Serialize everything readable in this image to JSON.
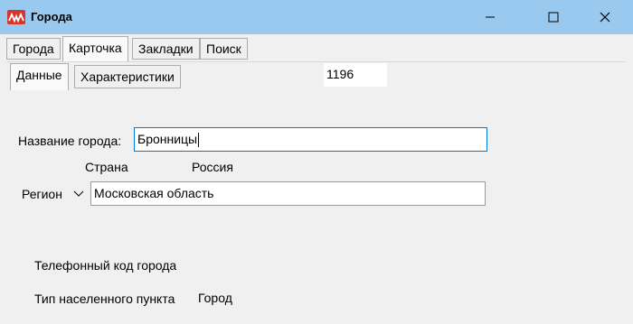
{
  "window": {
    "title": "Города"
  },
  "tabs": [
    "Города",
    "Карточка",
    "Закладки",
    "Поиск"
  ],
  "subtabs": [
    "Данные",
    "Характеристики"
  ],
  "record_id": "1196",
  "form": {
    "city_name_label": "Название города:",
    "city_name_value": "Бронницы",
    "country_label": "Страна",
    "country_value": "Россия",
    "region_label": "Регион",
    "region_value": "Московская область",
    "phone_code_label": "Телефонный код города",
    "settlement_type_label": "Тип населенного пункта",
    "settlement_type_value": "Город"
  },
  "colors": {
    "titlebar": "#99c9ef",
    "focus_border": "#0078d7",
    "icon": "#d6362a"
  }
}
